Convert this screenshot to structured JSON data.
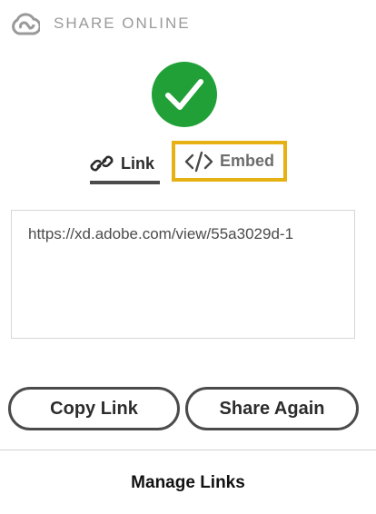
{
  "header": {
    "title": "SHARE ONLINE",
    "icon": "creative-cloud-icon"
  },
  "status": {
    "icon": "checkmark-icon",
    "color": "#21a037"
  },
  "tabs": [
    {
      "label": "Link",
      "icon": "link-icon",
      "active": true
    },
    {
      "label": "Embed",
      "icon": "code-icon",
      "active": false,
      "highlight_color": "#e6b113"
    }
  ],
  "link_field": {
    "value": "https://xd.adobe.com/view/55a3029d-1"
  },
  "buttons": {
    "copy_label": "Copy Link",
    "share_label": "Share Again"
  },
  "footer": {
    "manage_label": "Manage Links"
  }
}
